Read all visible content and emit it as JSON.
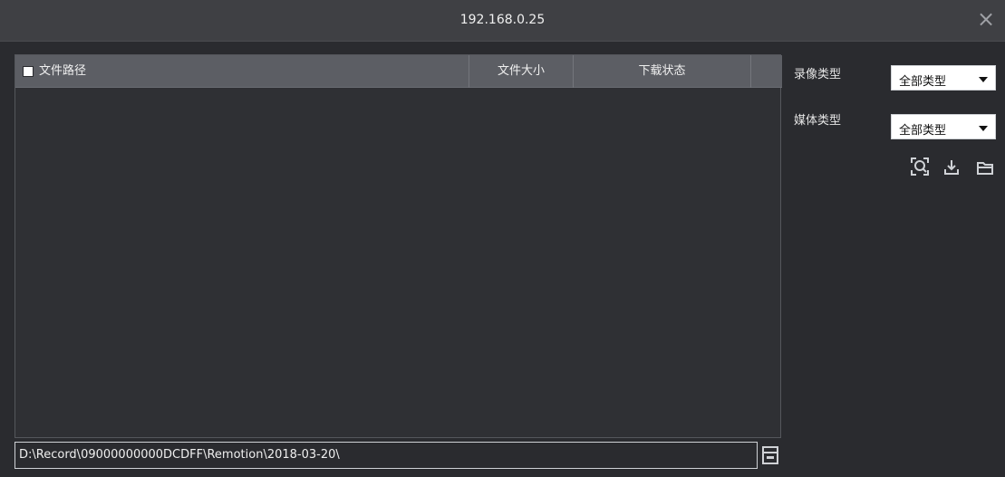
{
  "window": {
    "title": "192.168.0.25",
    "close_icon": "close-icon"
  },
  "file_list": {
    "columns": {
      "path": "文件路径",
      "size": "文件大小",
      "status": "下载状态",
      "extra": ""
    }
  },
  "path_bar": {
    "value": "D:\\Record\\09000000000DCDFF\\Remotion\\2018-03-20\\"
  },
  "filters": {
    "record_type_label": "录像类型",
    "record_type_value": "全部类型",
    "media_type_label": "媒体类型",
    "media_type_value": "全部类型"
  },
  "toolbar": {
    "icons": [
      "search-icon",
      "download-icon",
      "folder-icon"
    ]
  }
}
